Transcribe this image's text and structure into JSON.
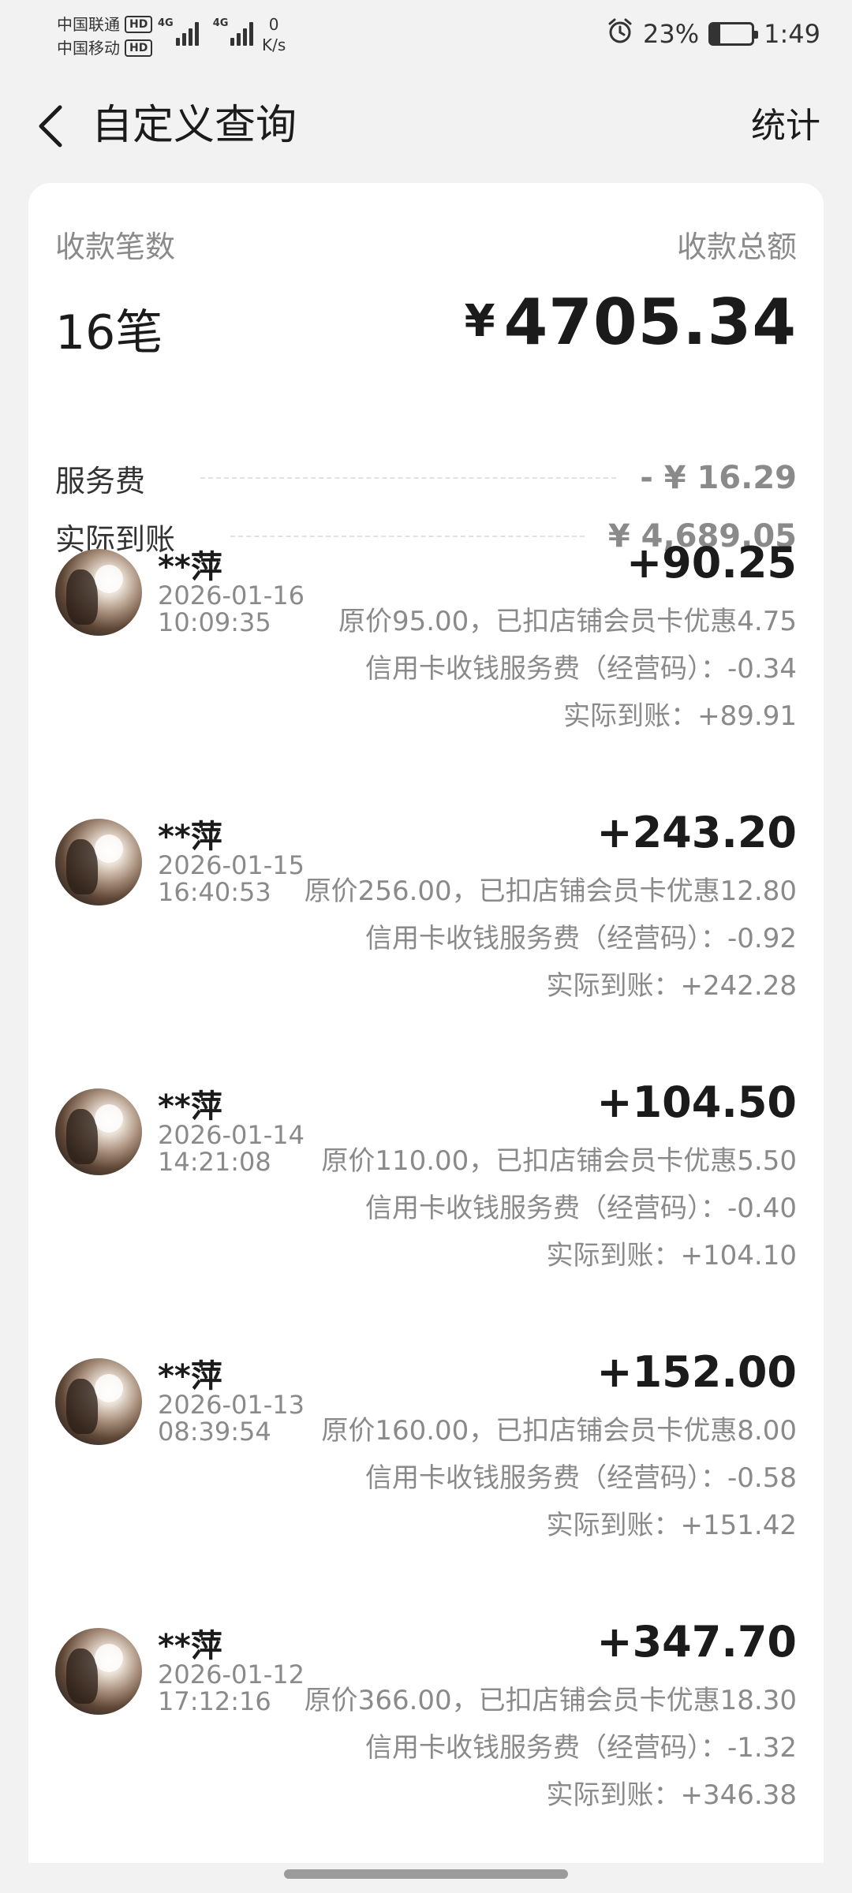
{
  "status_bar": {
    "carrier1": "中国联通",
    "carrier2": "中国移动",
    "hd": "HD",
    "net1": "4G",
    "net2": "4G",
    "speed_value": "0",
    "speed_unit": "K/s",
    "battery_percent": "23%",
    "battery_level": 0.23,
    "time": "1:49"
  },
  "header": {
    "title": "自定义查询",
    "stats_label": "统计"
  },
  "summary": {
    "count_label": "收款笔数",
    "total_label": "收款总额",
    "count_value": "16笔",
    "currency": "¥",
    "total_value": "4705.34",
    "fee_label": "服务费",
    "fee_value": "- ¥ 16.29",
    "actual_label": "实际到账",
    "actual_value": "¥ 4,689.05"
  },
  "transactions": [
    {
      "name": "**萍",
      "date": "2026-01-16",
      "time": "10:09:35",
      "amount": "+90.25",
      "original": "原价95.00，已扣店铺会员卡优惠4.75",
      "fee": "信用卡收钱服务费（经营码）：-0.34",
      "actual": "实际到账：+89.91"
    },
    {
      "name": "**萍",
      "date": "2026-01-15",
      "time": "16:40:53",
      "amount": "+243.20",
      "original": "原价256.00，已扣店铺会员卡优惠12.80",
      "fee": "信用卡收钱服务费（经营码）：-0.92",
      "actual": "实际到账：+242.28"
    },
    {
      "name": "**萍",
      "date": "2026-01-14",
      "time": "14:21:08",
      "amount": "+104.50",
      "original": "原价110.00，已扣店铺会员卡优惠5.50",
      "fee": "信用卡收钱服务费（经营码）：-0.40",
      "actual": "实际到账：+104.10"
    },
    {
      "name": "**萍",
      "date": "2026-01-13",
      "time": "08:39:54",
      "amount": "+152.00",
      "original": "原价160.00，已扣店铺会员卡优惠8.00",
      "fee": "信用卡收钱服务费（经营码）：-0.58",
      "actual": "实际到账：+151.42"
    },
    {
      "name": "**萍",
      "date": "2026-01-12",
      "time": "17:12:16",
      "amount": "+347.70",
      "original": "原价366.00，已扣店铺会员卡优惠18.30",
      "fee": "信用卡收钱服务费（经营码）：-1.32",
      "actual": "实际到账：+346.38"
    }
  ]
}
